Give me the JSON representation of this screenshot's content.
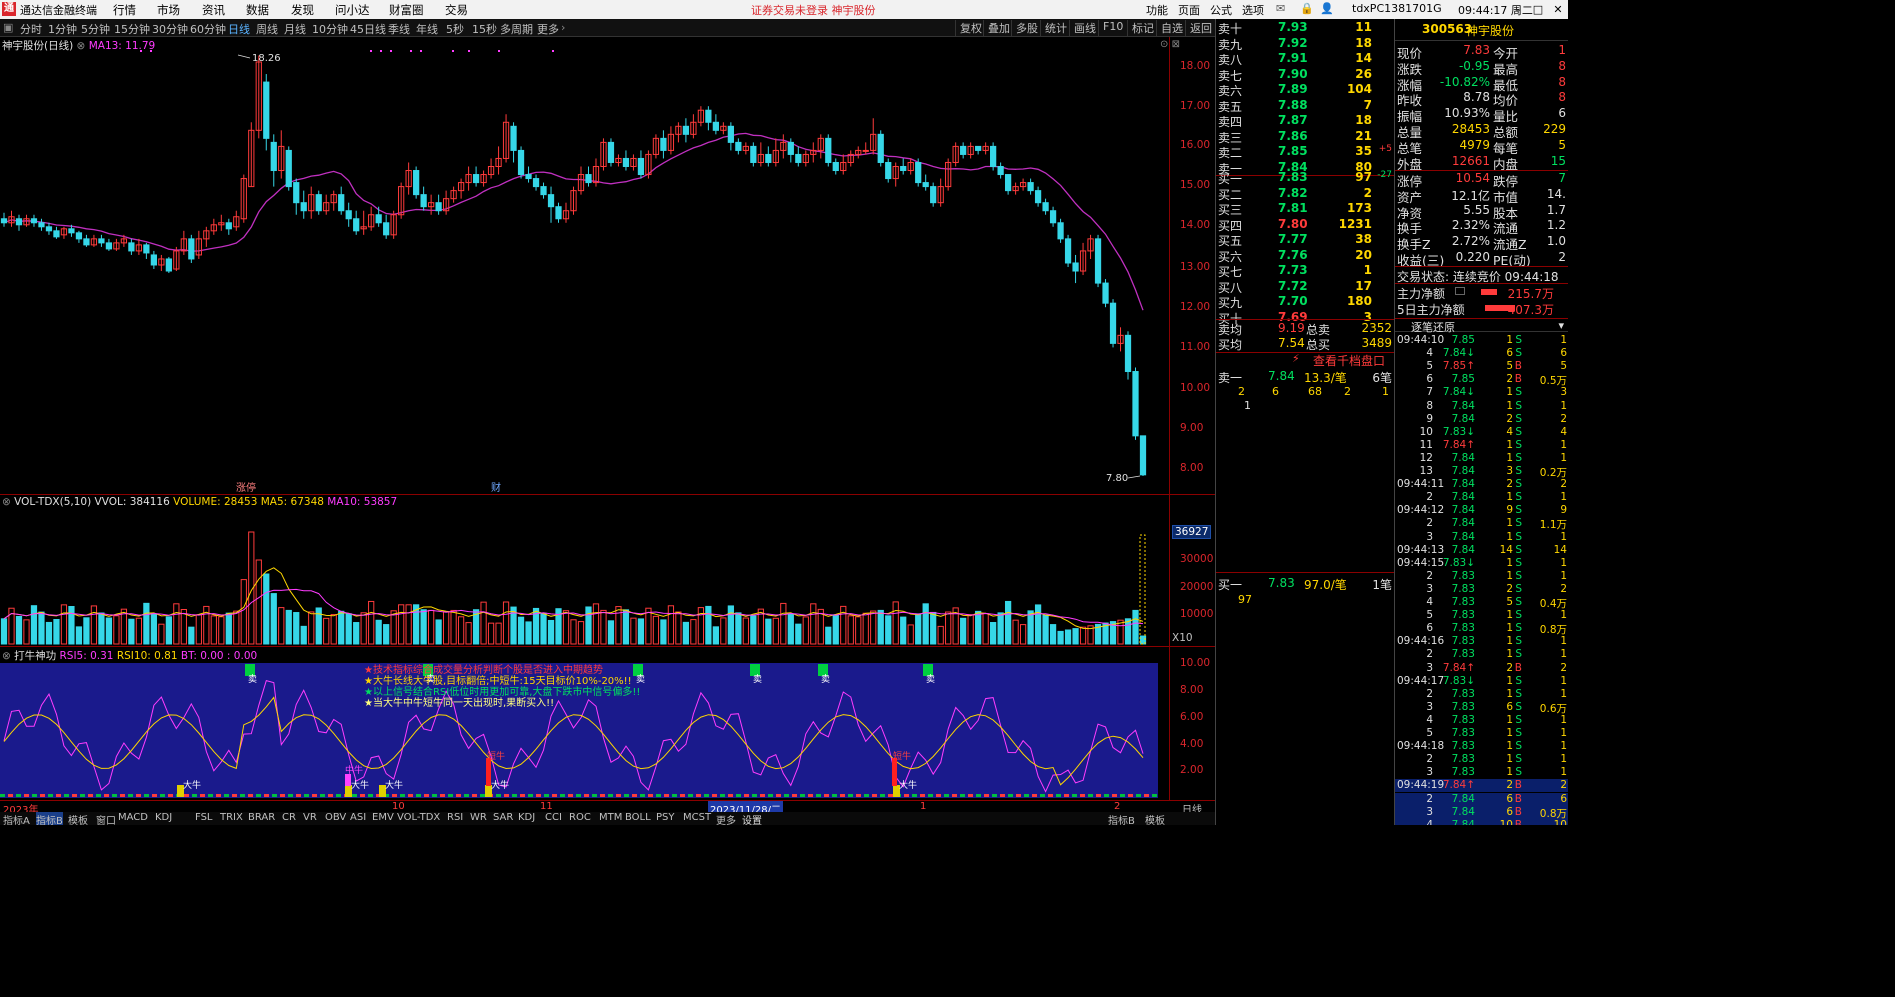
{
  "app": {
    "logo": "通",
    "title": "通达信金融终端",
    "menu": [
      "行情",
      "市场",
      "资讯",
      "数据",
      "发现",
      "问小达",
      "财富圈",
      "交易"
    ],
    "warning": "证券交易未登录  神宇股份",
    "right_menu": [
      "功能",
      "页面",
      "公式",
      "选项"
    ],
    "account": "tdxPC1381701G",
    "clock": "09:44:17 周二"
  },
  "periods": [
    "分时",
    "1分钟",
    "5分钟",
    "15分钟",
    "30分钟",
    "60分钟",
    "日线",
    "周线",
    "月线",
    "10分钟",
    "45日线",
    "季线",
    "年线",
    "5秒",
    "15秒",
    "多周期",
    "更多"
  ],
  "active_period": "日线",
  "tools": [
    "复权",
    "叠加",
    "多股",
    "统计",
    "画线",
    "F10",
    "标记",
    "自选",
    "返回"
  ],
  "kline": {
    "title": "神宇股份(日线)",
    "ma_label": "MA13: 11.79",
    "high_label": "18.26",
    "low_label": "7.80",
    "marker_zt": "涨停",
    "marker_cai": "财",
    "yaxis": [
      "18.00",
      "17.00",
      "16.00",
      "15.00",
      "14.00",
      "13.00",
      "12.00",
      "11.00",
      "10.00",
      "9.00",
      "8.00"
    ]
  },
  "volume": {
    "title": "VOL-TDX(5,10)",
    "vvol": "VVOL: 384116",
    "volume": "VOLUME: 28453",
    "ma5": "MA5: 67348",
    "ma10": "MA10: 53857",
    "box": "36927",
    "yaxis": [
      "30000",
      "20000",
      "10000"
    ],
    "unit": "X10"
  },
  "indicator": {
    "title": "打牛神功",
    "rsi5": "RSI5: 0.31",
    "rsi10": "RSI10: 0.81",
    "bt": "BT: 0.00 : 0.00",
    "lines": [
      "★技术指标综合成交量分析判断个股是否进入中期趋势",
      "★大牛长线大牛股,目标翻倍;中短牛:15天目标价10%-20%!!",
      "★以上信号结合RSI低位时用更加可靠,大盘下跌市中信号偏多!!",
      "★当大牛中牛短牛同一天出现时,果断买入!!"
    ],
    "yaxis": [
      "10.00",
      "8.00",
      "6.00",
      "4.00",
      "2.00"
    ],
    "bull_big": "大牛",
    "bull_mid": "中牛",
    "bull_short": "短牛",
    "sell": "卖"
  },
  "dates": {
    "year": "2023年",
    "m10": "10",
    "m11": "11",
    "cursor": "2023/11/28/二",
    "m1": "1",
    "m2": "2",
    "period": "日线"
  },
  "bottom_tabs": [
    "指标A",
    "指标B",
    "模板",
    "窗口",
    "MACD",
    "KDJ",
    "FSL",
    "TRIX",
    "BRAR",
    "CR",
    "VR",
    "OBV",
    "ASI",
    "EMV",
    "VOL-TDX",
    "RSI",
    "WR",
    "SAR",
    "KDJ",
    "CCI",
    "ROC",
    "MTM",
    "BOLL",
    "PSY",
    "MCST",
    "更多",
    "设置"
  ],
  "bottom_right": [
    "指标B",
    "模板"
  ],
  "orderbook": {
    "asks": [
      {
        "l": "卖十",
        "p": "7.93",
        "v": "11",
        "f": ""
      },
      {
        "l": "卖九",
        "p": "7.92",
        "v": "18",
        "f": ""
      },
      {
        "l": "卖八",
        "p": "7.91",
        "v": "14",
        "f": ""
      },
      {
        "l": "卖七",
        "p": "7.90",
        "v": "26",
        "f": ""
      },
      {
        "l": "卖六",
        "p": "7.89",
        "v": "104",
        "f": ""
      },
      {
        "l": "卖五",
        "p": "7.88",
        "v": "7",
        "f": ""
      },
      {
        "l": "卖四",
        "p": "7.87",
        "v": "18",
        "f": ""
      },
      {
        "l": "卖三",
        "p": "7.86",
        "v": "21",
        "f": ""
      },
      {
        "l": "卖二",
        "p": "7.85",
        "v": "35",
        "f": "+5"
      },
      {
        "l": "卖一",
        "p": "7.84",
        "v": "80",
        "f": ""
      }
    ],
    "bids": [
      {
        "l": "买一",
        "p": "7.83",
        "v": "97",
        "f": "-27"
      },
      {
        "l": "买二",
        "p": "7.82",
        "v": "2",
        "f": ""
      },
      {
        "l": "买三",
        "p": "7.81",
        "v": "173",
        "f": ""
      },
      {
        "l": "买四",
        "p": "7.80",
        "v": "1231",
        "f": ""
      },
      {
        "l": "买五",
        "p": "7.77",
        "v": "38",
        "f": ""
      },
      {
        "l": "买六",
        "p": "7.76",
        "v": "20",
        "f": ""
      },
      {
        "l": "买七",
        "p": "7.73",
        "v": "1",
        "f": ""
      },
      {
        "l": "买八",
        "p": "7.72",
        "v": "17",
        "f": ""
      },
      {
        "l": "买九",
        "p": "7.70",
        "v": "180",
        "f": ""
      },
      {
        "l": "买十",
        "p": "7.69",
        "v": "3",
        "f": ""
      }
    ],
    "sell_avg_l": "卖均",
    "sell_avg": "9.19",
    "total_sell_l": "总卖",
    "total_sell": "2352",
    "buy_avg_l": "买均",
    "buy_avg": "7.54",
    "total_buy_l": "总买",
    "total_buy": "3489",
    "level_btn": "查看千档盘口",
    "s1_l": "卖一",
    "s1_p": "7.84",
    "s1_avg": "13.3/笔",
    "s1_n": "6笔",
    "s1_q": [
      "2",
      "6",
      "68",
      "2",
      "1",
      "1"
    ],
    "b1_l": "买一",
    "b1_p": "7.83",
    "b1_avg": "97.0/笔",
    "b1_n": "1笔",
    "b1_q": "97"
  },
  "quote": {
    "code": "300563",
    "name": "神宇股份",
    "rows": [
      [
        "现价",
        "7.83",
        "今开",
        "1"
      ],
      [
        "涨跌",
        "-0.95",
        "最高",
        "8"
      ],
      [
        "涨幅",
        "-10.82%",
        "最低",
        "8"
      ],
      [
        "昨收",
        "8.78",
        "均价",
        "8"
      ],
      [
        "振幅",
        "10.93%",
        "量比",
        "6"
      ],
      [
        "总量",
        "28453",
        "总额",
        "229"
      ],
      [
        "总笔",
        "4979",
        "每笔",
        "5"
      ],
      [
        "外盘",
        "12661",
        "内盘",
        "15"
      ]
    ],
    "rows2": [
      [
        "涨停",
        "10.54",
        "跌停",
        "7"
      ],
      [
        "资产",
        "12.1亿",
        "市值",
        "14."
      ],
      [
        "净资",
        "5.55",
        "股本",
        "1.7"
      ],
      [
        "换手",
        "2.32%",
        "流通",
        "1.2"
      ],
      [
        "换手Z",
        "2.72%",
        "流通Z",
        "1.0"
      ],
      [
        "收益(三)",
        "0.220",
        "PE(动)",
        "2"
      ]
    ],
    "status": "交易状态: 连续竞价 09:44:18",
    "flow1_l": "主力净额",
    "flow1": "215.7万",
    "flow2_l": "5日主力净额",
    "flow2": "407.3万",
    "ticks_title": "逐笔还原",
    "ticks": [
      [
        "09:44:10",
        "7.85",
        "1",
        "S",
        "1"
      ],
      [
        "4",
        "7.84↓",
        "6",
        "S",
        "6"
      ],
      [
        "5",
        "7.85↑",
        "5",
        "B",
        "5"
      ],
      [
        "6",
        "7.85",
        "2",
        "B",
        "0.5万"
      ],
      [
        "7",
        "7.84↓",
        "1",
        "S",
        "3"
      ],
      [
        "8",
        "7.84",
        "1",
        "S",
        "1"
      ],
      [
        "9",
        "7.84",
        "2",
        "S",
        "2"
      ],
      [
        "10",
        "7.83↓",
        "4",
        "S",
        "4"
      ],
      [
        "11",
        "7.84↑",
        "1",
        "S",
        "1"
      ],
      [
        "12",
        "7.84",
        "1",
        "S",
        "1"
      ],
      [
        "13",
        "7.84",
        "3",
        "S",
        "0.2万"
      ],
      [
        "09:44:11",
        "7.84",
        "2",
        "S",
        "2"
      ],
      [
        "2",
        "7.84",
        "1",
        "S",
        "1"
      ],
      [
        "09:44:12",
        "7.84",
        "9",
        "S",
        "9"
      ],
      [
        "2",
        "7.84",
        "1",
        "S",
        "1.1万"
      ],
      [
        "3",
        "7.84",
        "1",
        "S",
        "1"
      ],
      [
        "09:44:13",
        "7.84",
        "14",
        "S",
        "14"
      ],
      [
        "09:44:15",
        "7.83↓",
        "1",
        "S",
        "1"
      ],
      [
        "2",
        "7.83",
        "1",
        "S",
        "1"
      ],
      [
        "3",
        "7.83",
        "2",
        "S",
        "2"
      ],
      [
        "4",
        "7.83",
        "5",
        "S",
        "0.4万"
      ],
      [
        "5",
        "7.83",
        "1",
        "S",
        "1"
      ],
      [
        "6",
        "7.83",
        "1",
        "S",
        "0.8万"
      ],
      [
        "09:44:16",
        "7.83",
        "1",
        "S",
        "1"
      ],
      [
        "2",
        "7.83",
        "1",
        "S",
        "1"
      ],
      [
        "3",
        "7.84↑",
        "2",
        "B",
        "2"
      ],
      [
        "09:44:17",
        "7.83↓",
        "1",
        "S",
        "1"
      ],
      [
        "2",
        "7.83",
        "1",
        "S",
        "1"
      ],
      [
        "3",
        "7.83",
        "6",
        "S",
        "0.6万"
      ],
      [
        "4",
        "7.83",
        "1",
        "S",
        "1"
      ],
      [
        "5",
        "7.83",
        "1",
        "S",
        "1"
      ],
      [
        "09:44:18",
        "7.83",
        "1",
        "S",
        "1"
      ],
      [
        "2",
        "7.83",
        "1",
        "S",
        "1"
      ],
      [
        "3",
        "7.83",
        "1",
        "S",
        "1"
      ],
      [
        "09:44:19",
        "7.84↑",
        "2",
        "B",
        "2"
      ],
      [
        "2",
        "7.84",
        "6",
        "B",
        "6"
      ],
      [
        "3",
        "7.84",
        "6",
        "B",
        "0.8万"
      ],
      [
        "4",
        "7.84",
        "10",
        "B",
        "10"
      ]
    ]
  }
}
